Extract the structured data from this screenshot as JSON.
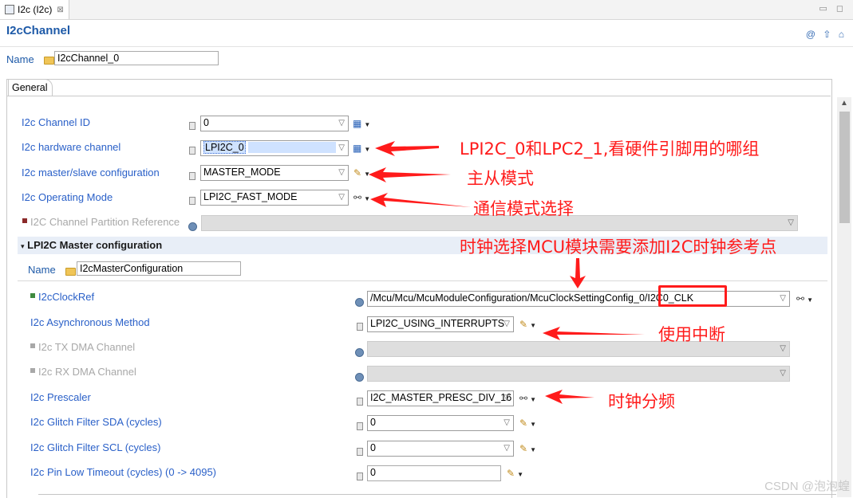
{
  "tab": {
    "label": "I2c (I2c)",
    "close_symbol": "⊠"
  },
  "window_controls": "▭ ◻",
  "header": {
    "title": "I2cChannel",
    "icons": "@ ⇧ ⌂"
  },
  "name_row": {
    "label": "Name",
    "value": "I2cChannel_0"
  },
  "general_tab": "General",
  "rows": [
    {
      "label": "I2c Channel ID",
      "value": "0",
      "state": "enabled"
    },
    {
      "label": "I2c hardware channel",
      "value": "LPI2C_0",
      "state": "enabled",
      "selected": true
    },
    {
      "label": "I2c master/slave configuration",
      "value": "MASTER_MODE",
      "state": "enabled"
    },
    {
      "label": "I2c Operating Mode",
      "value": "LPI2C_FAST_MODE",
      "state": "enabled"
    },
    {
      "label": "I2C Channel Partition Reference",
      "value": "",
      "state": "disabled"
    }
  ],
  "master_config": {
    "section_title": "LPI2C Master configuration",
    "name_label": "Name",
    "name_value": "I2cMasterConfiguration",
    "rows": [
      {
        "label": "I2cClockRef",
        "value": "/Mcu/Mcu/McuModuleConfiguration/McuClockSettingConfig_0/I2C0_CLK",
        "state": "enabled"
      },
      {
        "label": "I2c Asynchronous Method",
        "value": "LPI2C_USING_INTERRUPTS",
        "state": "enabled"
      },
      {
        "label": "I2c TX DMA Channel",
        "value": "",
        "state": "disabled"
      },
      {
        "label": "I2c RX DMA Channel",
        "value": "",
        "state": "disabled"
      },
      {
        "label": "I2c Prescaler",
        "value": "I2C_MASTER_PRESC_DIV_16",
        "state": "enabled"
      },
      {
        "label": "I2c Glitch Filter SDA (cycles)",
        "value": "0",
        "state": "enabled"
      },
      {
        "label": "I2c Glitch Filter SCL (cycles)",
        "value": "0",
        "state": "enabled"
      },
      {
        "label": "I2c Pin Low Timeout (cycles) (0 -> 4095)",
        "value": "0",
        "state": "enabled"
      }
    ]
  },
  "annotations": {
    "hardware_channel": "LPI2C_0和LPC2_1,看硬件引脚用的哪组",
    "master_slave": "主从模式",
    "operating_mode": "通信模式选择",
    "clock_ref": "时钟选择MCU模块需要添加I2C时钟参考点",
    "async_method": "使用中断",
    "prescaler": "时钟分频"
  },
  "watermark": "CSDN @泡泡蝗",
  "colors": {
    "label_blue": "#2a60c8",
    "title_blue": "#1e5aa8",
    "annotation_red": "#ff1b1b",
    "disabled_gray": "#a8a8a8"
  }
}
